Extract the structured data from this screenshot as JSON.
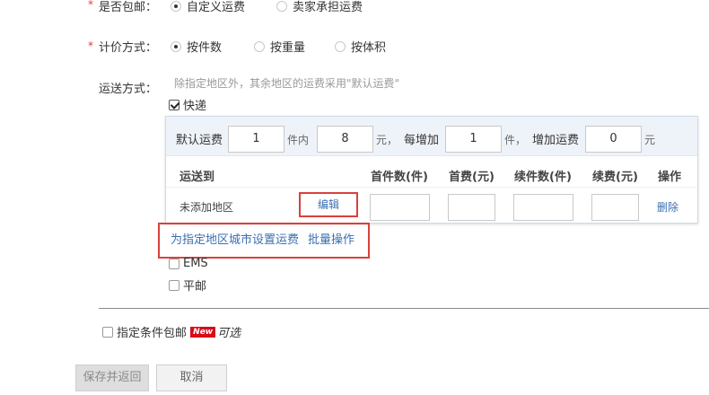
{
  "free_shipping": {
    "label": "是否包邮：",
    "options": [
      "自定义运费",
      "卖家承担运费"
    ],
    "selected": 0
  },
  "pricing": {
    "label": "计价方式：",
    "options": [
      "按件数",
      "按重量",
      "按体积"
    ],
    "selected": 0
  },
  "delivery": {
    "label": "运送方式：",
    "hint": "除指定地区外，其余地区的运费采用\"默认运费\"",
    "express": {
      "label": "快递",
      "checked": true,
      "default_fee_label": "默认运费",
      "first_qty": "1",
      "unit_within": "件内",
      "first_fee": "8",
      "currency1": "元，",
      "each_add_label": "每增加",
      "add_qty": "1",
      "unit_piece": "件，",
      "add_fee_label": "增加运费",
      "add_fee": "0",
      "currency2": "元",
      "columns": [
        "运送到",
        "首件数(件)",
        "首费(元)",
        "续件数(件)",
        "续费(元)",
        "操作"
      ],
      "row": {
        "region": "未添加地区",
        "edit": "编辑",
        "delete": "删除"
      },
      "set_region_link": "为指定地区城市设置运费",
      "batch_link": "批量操作"
    },
    "ems": {
      "label": "EMS",
      "checked": false
    },
    "surface_mail": {
      "label": "平邮",
      "checked": false
    }
  },
  "conditional_free": {
    "label": "指定条件包邮",
    "badge": "New",
    "optional": "可选",
    "checked": false
  },
  "buttons": {
    "save_return": "保存并返回",
    "cancel": "取消"
  },
  "colors": {
    "accent_red": "#d9413c",
    "link_blue": "#3a6fb0",
    "panel_header": "#eef3fa"
  }
}
